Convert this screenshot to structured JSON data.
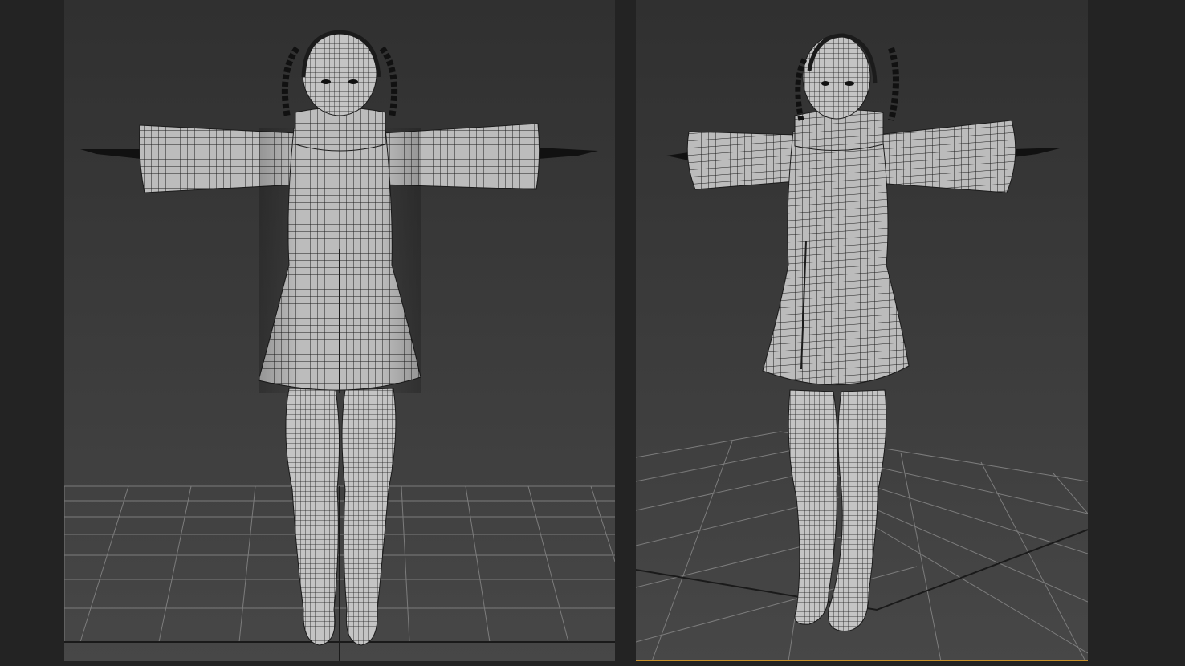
{
  "viewports": [
    {
      "id": "front",
      "label": "",
      "active": false
    },
    {
      "id": "perspective",
      "label": "",
      "active": true
    }
  ],
  "colors": {
    "background": "#232323",
    "viewport_top": "#303030",
    "viewport_bottom": "#474747",
    "grid_line": "#7c7c7c",
    "grid_axis": "#1a1a1a",
    "mesh_fill": "#b9b9b9",
    "wire": "#1b1b1b",
    "active_border": "#c8902a"
  },
  "icons": {
    "model": "wireframe-character-model"
  }
}
